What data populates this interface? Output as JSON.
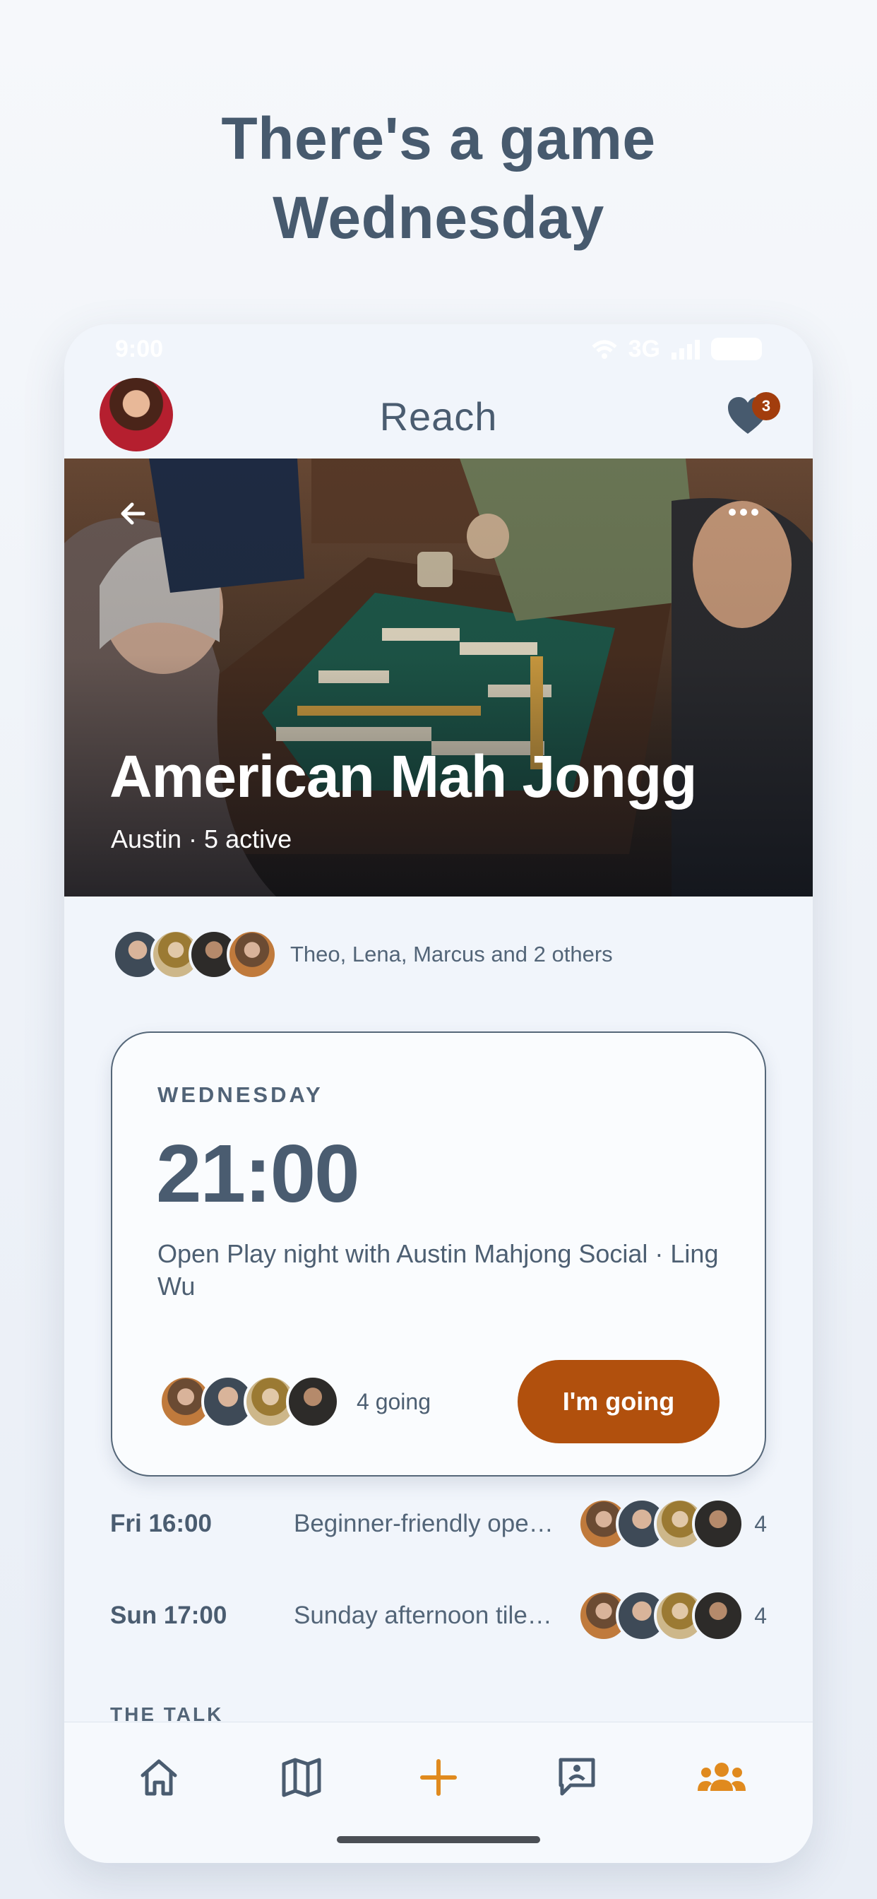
{
  "headline": {
    "line1": "There's a game",
    "line2": "Wednesday"
  },
  "status_bar": {
    "time": "9:00",
    "network": "3G"
  },
  "top_bar": {
    "app_name": "Reach",
    "notification_count": "3"
  },
  "hero": {
    "title": "American Mah Jongg",
    "subtitle": "Austin · 5 active"
  },
  "members": {
    "text": "Theo, Lena, Marcus and 2 others"
  },
  "next_event": {
    "day": "WEDNESDAY",
    "time": "21:00",
    "description": "Open Play night with Austin Mahjong Social · Ling Wu",
    "going_text": "4 going",
    "going_button": "I'm going"
  },
  "sessions": [
    {
      "day": "Fri 16:00",
      "title": "Beginner-friendly ope…",
      "count": "4"
    },
    {
      "day": "Sun 17:00",
      "title": "Sunday afternoon tile…",
      "count": "4"
    }
  ],
  "section": {
    "talk_label": "THE TALK"
  },
  "tabbar": {
    "items": [
      {
        "icon": "home-icon",
        "active": false
      },
      {
        "icon": "map-icon",
        "active": false
      },
      {
        "icon": "plus-icon",
        "active": true
      },
      {
        "icon": "chat-icon",
        "active": false
      },
      {
        "icon": "groups-icon",
        "active": true
      }
    ]
  },
  "colors": {
    "accent": "#b1500d",
    "text": "#4a5c70",
    "background": "#f1f5fb",
    "tab_active": "#e08a1e"
  }
}
